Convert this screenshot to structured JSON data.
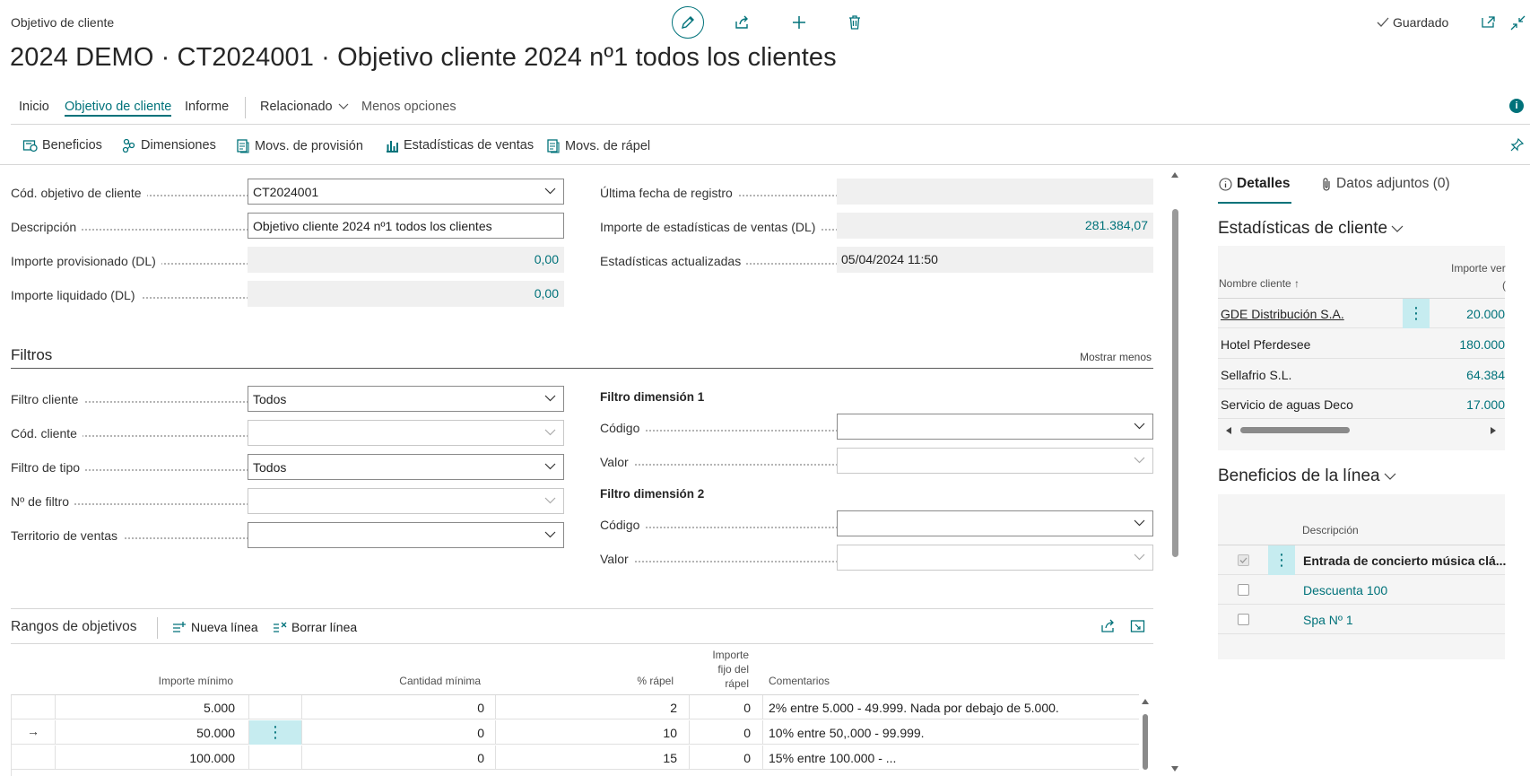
{
  "header": {
    "caption": "Objetivo de cliente",
    "title": "2024 DEMO · CT2024001 · Objetivo cliente 2024 nº1 todos los clientes",
    "saved": "Guardado"
  },
  "nav": {
    "tabs": [
      "Inicio",
      "Objetivo de cliente",
      "Informe",
      "Relacionado",
      "Menos opciones"
    ],
    "active": "Objetivo de cliente"
  },
  "actions": [
    "Beneficios",
    "Dimensiones",
    "Movs. de provisión",
    "Estadísticas de ventas",
    "Movs. de rápel"
  ],
  "general": {
    "left": [
      {
        "label": "Cód. objetivo de cliente",
        "value": "CT2024001"
      },
      {
        "label": "Descripción",
        "value": "Objetivo cliente 2024 nº1 todos los clientes"
      },
      {
        "label": "Importe provisionado (DL)",
        "value": "0,00"
      },
      {
        "label": "Importe liquidado (DL)",
        "value": "0,00"
      }
    ],
    "right": [
      {
        "label": "Última fecha de registro",
        "value": ""
      },
      {
        "label": "Importe de estadísticas de ventas (DL)",
        "value": "281.384,07"
      },
      {
        "label": "Estadísticas actualizadas",
        "value": "05/04/2024 11:50"
      }
    ]
  },
  "filters": {
    "title": "Filtros",
    "show_less": "Mostrar menos",
    "left": [
      {
        "label": "Filtro cliente",
        "value": "Todos"
      },
      {
        "label": "Cód. cliente",
        "value": ""
      },
      {
        "label": "Filtro de tipo",
        "value": "Todos"
      },
      {
        "label": "Nº de filtro",
        "value": ""
      },
      {
        "label": "Territorio de ventas",
        "value": ""
      }
    ],
    "dim1": {
      "title": "Filtro dimensión 1",
      "code_label": "Código",
      "value_label": "Valor"
    },
    "dim2": {
      "title": "Filtro dimensión 2",
      "code_label": "Código",
      "value_label": "Valor"
    }
  },
  "ranges": {
    "title": "Rangos de objetivos",
    "new_line": "Nueva línea",
    "delete_line": "Borrar línea",
    "columns": {
      "min_amount": "Importe mínimo",
      "min_qty": "Cantidad mínima",
      "pct": "% rápel",
      "fixed_1": "Importe",
      "fixed_2": "fijo del",
      "fixed_3": "rápel",
      "comments": "Comentarios"
    },
    "rows": [
      {
        "min_amount": "5.000",
        "min_qty": "0",
        "pct": "2",
        "fixed": "0",
        "comment": "2% entre 5.000 - 49.999. Nada por debajo de 5.000."
      },
      {
        "min_amount": "50.000",
        "min_qty": "0",
        "pct": "10",
        "fixed": "0",
        "comment": "10% entre 50,.000 - 99.999."
      },
      {
        "min_amount": "100.000",
        "min_qty": "0",
        "pct": "15",
        "fixed": "0",
        "comment": "15% entre 100.000 - ..."
      }
    ]
  },
  "factbox": {
    "tab_details": "Detalles",
    "tab_attachments": "Datos adjuntos (0)",
    "stats": {
      "title": "Estadísticas de cliente",
      "col_name": "Nombre cliente ↑",
      "col_amount": "Importe ver",
      "col_amount_2": "(",
      "rows": [
        {
          "name": "GDE Distribución S.A.",
          "amount": "20.000"
        },
        {
          "name": "Hotel Pferdesee",
          "amount": "180.000"
        },
        {
          "name": "Sellafrio S.L.",
          "amount": "64.384"
        },
        {
          "name": "Servicio de aguas Deco",
          "amount": "17.000"
        }
      ]
    },
    "benefits": {
      "title": "Beneficios de la línea",
      "col_desc": "Descripción",
      "rows": [
        {
          "desc": "Entrada de concierto música clá..."
        },
        {
          "desc": "Descuenta 100"
        },
        {
          "desc": "Spa Nº 1"
        }
      ]
    }
  },
  "colors": {
    "accent": "#00727a",
    "selection": "#c6ecf0",
    "readonly": "#f0f0f0"
  }
}
